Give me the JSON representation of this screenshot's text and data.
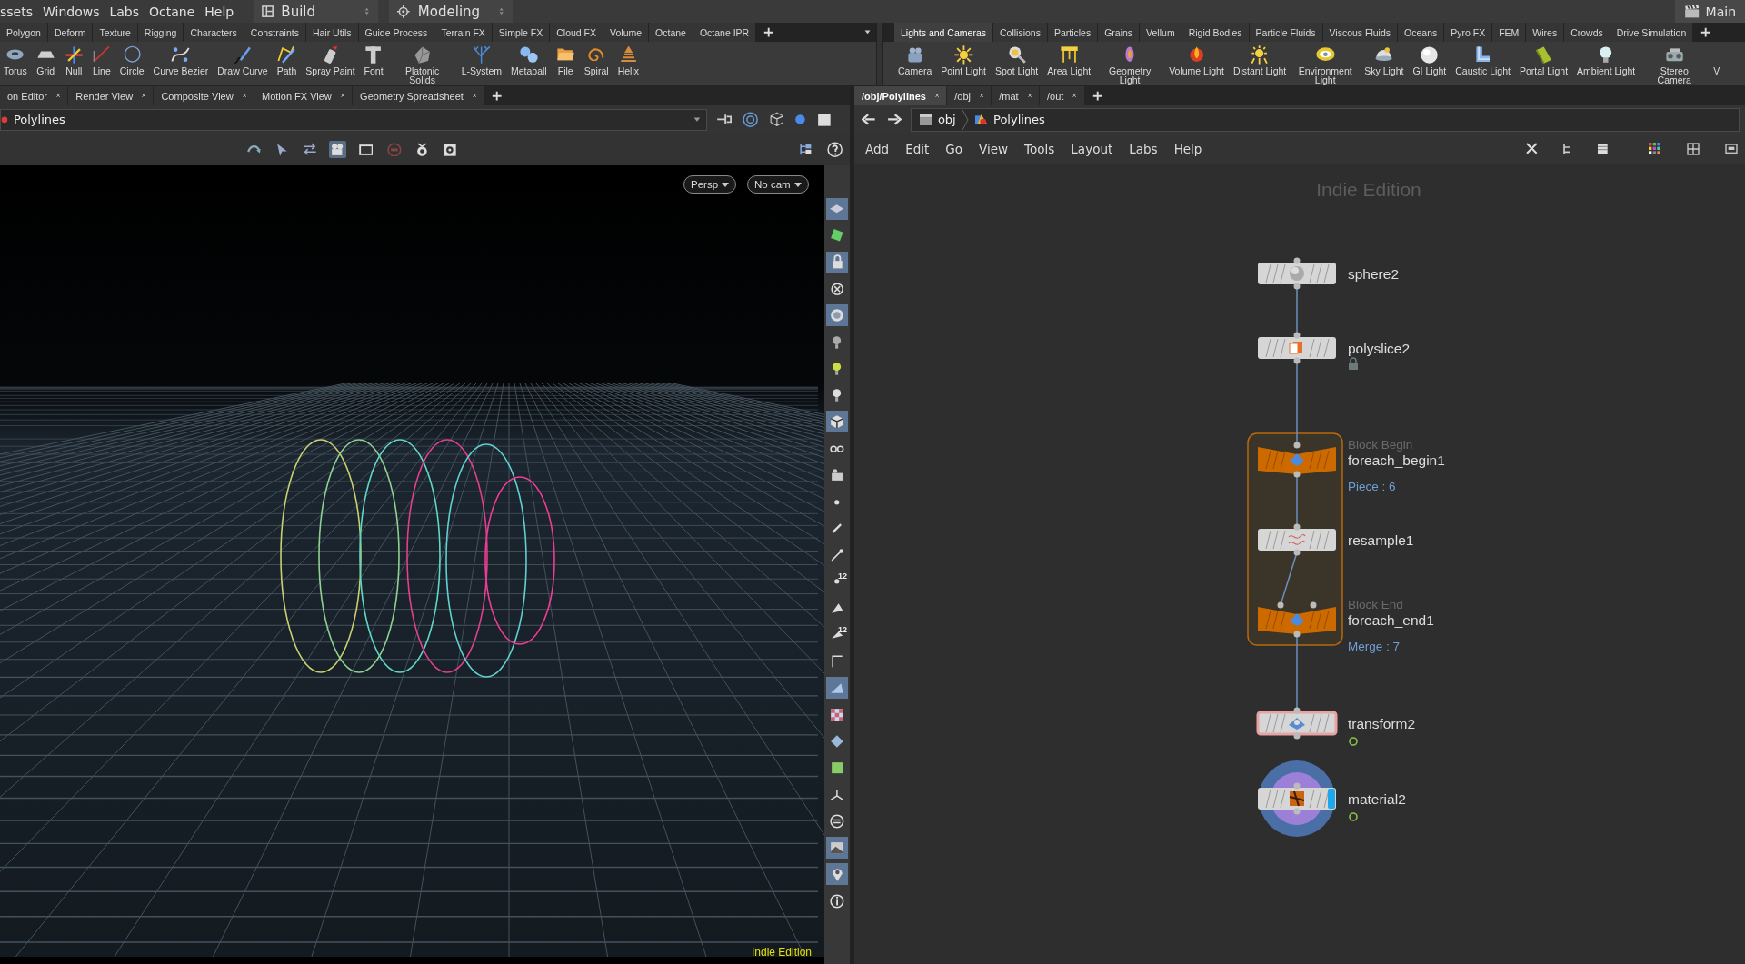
{
  "menu_bar": {
    "items": [
      "ssets",
      "Windows",
      "Labs",
      "Octane",
      "Help"
    ],
    "desktop": "Build",
    "context": "Modeling",
    "main": "Main"
  },
  "shelf_left": {
    "tabs": [
      {
        "label": "Polygon",
        "selected": false
      },
      {
        "label": "Deform",
        "selected": false
      },
      {
        "label": "Texture",
        "selected": false
      },
      {
        "label": "Rigging",
        "selected": false
      },
      {
        "label": "Characters",
        "selected": false
      },
      {
        "label": "Constraints",
        "selected": false
      },
      {
        "label": "Hair Utils",
        "selected": false
      },
      {
        "label": "Guide Process",
        "selected": false
      },
      {
        "label": "Terrain FX",
        "selected": false
      },
      {
        "label": "Simple FX",
        "selected": false
      },
      {
        "label": "Cloud FX",
        "selected": false
      },
      {
        "label": "Volume",
        "selected": false
      },
      {
        "label": "Octane",
        "selected": false
      },
      {
        "label": "Octane IPR",
        "selected": false
      }
    ],
    "tools": [
      "Torus",
      "Grid",
      "Null",
      "Line",
      "Circle",
      "Curve Bezier",
      "Draw Curve",
      "Path",
      "Spray Paint",
      "Font",
      "Platonic Solids",
      "L-System",
      "Metaball",
      "File",
      "Spiral",
      "Helix"
    ]
  },
  "shelf_right": {
    "tabs": [
      {
        "label": "Lights and Cameras",
        "selected": true
      },
      {
        "label": "Collisions",
        "selected": false
      },
      {
        "label": "Particles",
        "selected": false
      },
      {
        "label": "Grains",
        "selected": false
      },
      {
        "label": "Vellum",
        "selected": false
      },
      {
        "label": "Rigid Bodies",
        "selected": false
      },
      {
        "label": "Particle Fluids",
        "selected": false
      },
      {
        "label": "Viscous Fluids",
        "selected": false
      },
      {
        "label": "Oceans",
        "selected": false
      },
      {
        "label": "Pyro FX",
        "selected": false
      },
      {
        "label": "FEM",
        "selected": false
      },
      {
        "label": "Wires",
        "selected": false
      },
      {
        "label": "Crowds",
        "selected": false
      },
      {
        "label": "Drive Simulation",
        "selected": false
      }
    ],
    "tools": [
      "Camera",
      "Point Light",
      "Spot Light",
      "Area Light",
      "Geometry Light",
      "Volume Light",
      "Distant Light",
      "Environment Light",
      "Sky Light",
      "GI Light",
      "Caustic Light",
      "Portal Light",
      "Ambient Light",
      "Stereo Camera",
      "V"
    ]
  },
  "scene_pane": {
    "tabs": [
      {
        "label": "on Editor",
        "selected": false
      },
      {
        "label": "Render View",
        "selected": false
      },
      {
        "label": "Composite View",
        "selected": false
      },
      {
        "label": "Motion FX View",
        "selected": false
      },
      {
        "label": "Geometry Spreadsheet",
        "selected": false
      }
    ],
    "path": "Polylines",
    "viewport": {
      "camera_menus": [
        "Persp",
        "No cam"
      ],
      "edition": "Indie Edition",
      "tools": [
        {
          "selected": true
        },
        {
          "selected": false
        },
        {
          "selected": true
        },
        {
          "selected": false
        },
        {
          "selected": true
        },
        {
          "selected": false
        },
        {
          "selected": false
        },
        {
          "selected": false
        },
        {
          "selected": true
        },
        {
          "selected": false
        },
        {
          "selected": false
        },
        {
          "selected": false
        },
        {
          "selected": false
        },
        {
          "selected": false
        },
        {
          "selected": false,
          "label": "12"
        },
        {
          "selected": false
        },
        {
          "selected": false,
          "label": "12"
        },
        {
          "selected": false
        },
        {
          "selected": true
        },
        {
          "selected": false
        },
        {
          "selected": false
        },
        {
          "selected": false
        },
        {
          "selected": false
        },
        {
          "selected": false
        },
        {
          "selected": true
        },
        {
          "selected": true
        },
        {
          "selected": false
        }
      ]
    }
  },
  "network_pane": {
    "tabs": [
      {
        "label": "/obj/Polylines",
        "selected": true
      },
      {
        "label": "/obj",
        "selected": false
      },
      {
        "label": "/mat",
        "selected": false
      },
      {
        "label": "/out",
        "selected": false
      }
    ],
    "path": [
      "obj",
      "Polylines"
    ],
    "menu": [
      "Add",
      "Edit",
      "Go",
      "View",
      "Tools",
      "Layout",
      "Labs",
      "Help"
    ],
    "edition": "Indie Edition",
    "nodes": [
      {
        "name": "sphere2",
        "kind": "sop",
        "selected": false,
        "display": false,
        "locked": false,
        "time_dependent": false
      },
      {
        "name": "polyslice2",
        "kind": "sop",
        "selected": false,
        "display": false,
        "locked": true,
        "time_dependent": false
      },
      {
        "name": "foreach_begin1",
        "kind": "block",
        "label": "Block Begin",
        "info": "Piece : 6",
        "selected": false,
        "display": false,
        "locked": false,
        "time_dependent": false
      },
      {
        "name": "resample1",
        "kind": "sop",
        "selected": false,
        "display": false,
        "locked": false,
        "time_dependent": false
      },
      {
        "name": "foreach_end1",
        "kind": "block",
        "label": "Block End",
        "info": "Merge : 7",
        "selected": false,
        "display": false,
        "locked": false,
        "time_dependent": false
      },
      {
        "name": "transform2",
        "kind": "sop",
        "selected": true,
        "display": false,
        "locked": false,
        "time_dependent": true
      },
      {
        "name": "material2",
        "kind": "sop",
        "selected": false,
        "display": true,
        "locked": false,
        "time_dependent": true
      }
    ]
  }
}
